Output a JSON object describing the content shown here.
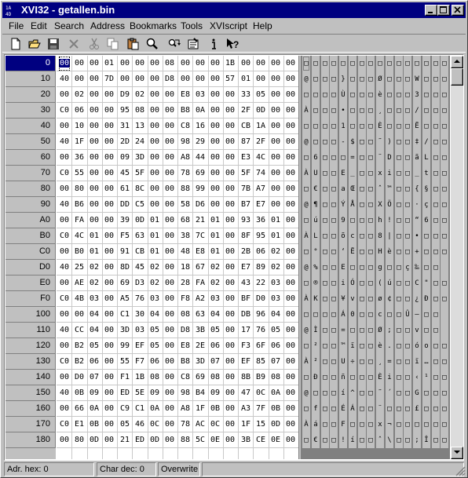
{
  "window": {
    "title": "XVI32 - getallen.bin",
    "app_icon_text": "XVI"
  },
  "menu": [
    "File",
    "Edit",
    "Search",
    "Address",
    "Bookmarks",
    "Tools",
    "XVIscript",
    "Help"
  ],
  "toolbar": [
    {
      "icon": "new-file-icon"
    },
    {
      "icon": "open-folder-icon"
    },
    {
      "icon": "save-disk-icon"
    },
    {
      "icon": "close-x-icon"
    },
    {
      "icon": "cut-scissors-icon"
    },
    {
      "icon": "copy-icon"
    },
    {
      "icon": "paste-icon"
    },
    {
      "icon": "find-magnifier-icon"
    },
    {
      "icon": "replace-icon"
    },
    {
      "icon": "settings-icon"
    },
    {
      "icon": "info-icon"
    },
    {
      "icon": "help-pointer-icon"
    }
  ],
  "addresses": [
    "0",
    "10",
    "20",
    "30",
    "40",
    "50",
    "60",
    "70",
    "80",
    "90",
    "A0",
    "B0",
    "C0",
    "D0",
    "E0",
    "F0",
    "100",
    "110",
    "120",
    "130",
    "140",
    "150",
    "160",
    "170",
    "180"
  ],
  "hex_rows": [
    [
      "00",
      "00",
      "00",
      "01",
      "00",
      "00",
      "00",
      "08",
      "00",
      "00",
      "00",
      "1B",
      "00",
      "00",
      "00"
    ],
    [
      "40",
      "00",
      "00",
      "7D",
      "00",
      "00",
      "00",
      "D8",
      "00",
      "00",
      "00",
      "57",
      "01",
      "00",
      "00"
    ],
    [
      "00",
      "02",
      "00",
      "00",
      "D9",
      "02",
      "00",
      "00",
      "E8",
      "03",
      "00",
      "00",
      "33",
      "05",
      "00"
    ],
    [
      "C0",
      "06",
      "00",
      "00",
      "95",
      "08",
      "00",
      "00",
      "B8",
      "0A",
      "00",
      "00",
      "2F",
      "0D",
      "00"
    ],
    [
      "00",
      "10",
      "00",
      "00",
      "31",
      "13",
      "00",
      "00",
      "C8",
      "16",
      "00",
      "00",
      "CB",
      "1A",
      "00"
    ],
    [
      "40",
      "1F",
      "00",
      "00",
      "2D",
      "24",
      "00",
      "00",
      "98",
      "29",
      "00",
      "00",
      "87",
      "2F",
      "00"
    ],
    [
      "00",
      "36",
      "00",
      "00",
      "09",
      "3D",
      "00",
      "00",
      "A8",
      "44",
      "00",
      "00",
      "E3",
      "4C",
      "00"
    ],
    [
      "C0",
      "55",
      "00",
      "00",
      "45",
      "5F",
      "00",
      "00",
      "78",
      "69",
      "00",
      "00",
      "5F",
      "74",
      "00"
    ],
    [
      "00",
      "80",
      "00",
      "00",
      "61",
      "8C",
      "00",
      "00",
      "88",
      "99",
      "00",
      "00",
      "7B",
      "A7",
      "00"
    ],
    [
      "40",
      "B6",
      "00",
      "00",
      "DD",
      "C5",
      "00",
      "00",
      "58",
      "D6",
      "00",
      "00",
      "B7",
      "E7",
      "00"
    ],
    [
      "00",
      "FA",
      "00",
      "00",
      "39",
      "0D",
      "01",
      "00",
      "68",
      "21",
      "01",
      "00",
      "93",
      "36",
      "01"
    ],
    [
      "C0",
      "4C",
      "01",
      "00",
      "F5",
      "63",
      "01",
      "00",
      "38",
      "7C",
      "01",
      "00",
      "8F",
      "95",
      "01"
    ],
    [
      "00",
      "B0",
      "01",
      "00",
      "91",
      "CB",
      "01",
      "00",
      "48",
      "E8",
      "01",
      "00",
      "2B",
      "06",
      "02"
    ],
    [
      "40",
      "25",
      "02",
      "00",
      "8D",
      "45",
      "02",
      "00",
      "18",
      "67",
      "02",
      "00",
      "E7",
      "89",
      "02"
    ],
    [
      "00",
      "AE",
      "02",
      "00",
      "69",
      "D3",
      "02",
      "00",
      "28",
      "FA",
      "02",
      "00",
      "43",
      "22",
      "03"
    ],
    [
      "C0",
      "4B",
      "03",
      "00",
      "A5",
      "76",
      "03",
      "00",
      "F8",
      "A2",
      "03",
      "00",
      "BF",
      "D0",
      "03"
    ],
    [
      "00",
      "00",
      "04",
      "00",
      "C1",
      "30",
      "04",
      "00",
      "08",
      "63",
      "04",
      "00",
      "DB",
      "96",
      "04"
    ],
    [
      "40",
      "CC",
      "04",
      "00",
      "3D",
      "03",
      "05",
      "00",
      "D8",
      "3B",
      "05",
      "00",
      "17",
      "76",
      "05"
    ],
    [
      "00",
      "B2",
      "05",
      "00",
      "99",
      "EF",
      "05",
      "00",
      "E8",
      "2E",
      "06",
      "00",
      "F3",
      "6F",
      "06"
    ],
    [
      "C0",
      "B2",
      "06",
      "00",
      "55",
      "F7",
      "06",
      "00",
      "B8",
      "3D",
      "07",
      "00",
      "EF",
      "85",
      "07"
    ],
    [
      "00",
      "D0",
      "07",
      "00",
      "F1",
      "1B",
      "08",
      "00",
      "C8",
      "69",
      "08",
      "00",
      "8B",
      "B9",
      "08"
    ],
    [
      "40",
      "0B",
      "09",
      "00",
      "ED",
      "5E",
      "09",
      "00",
      "98",
      "B4",
      "09",
      "00",
      "47",
      "0C",
      "0A"
    ],
    [
      "00",
      "66",
      "0A",
      "00",
      "C9",
      "C1",
      "0A",
      "00",
      "A8",
      "1F",
      "0B",
      "00",
      "A3",
      "7F",
      "0B"
    ],
    [
      "C0",
      "E1",
      "0B",
      "00",
      "05",
      "46",
      "0C",
      "00",
      "78",
      "AC",
      "0C",
      "00",
      "1F",
      "15",
      "0D"
    ],
    [
      "00",
      "80",
      "0D",
      "00",
      "21",
      "ED",
      "0D",
      "00",
      "88",
      "5C",
      "0E",
      "00",
      "3B",
      "CE",
      "0E"
    ]
  ],
  "hex_last_col": [
    "00",
    "00",
    "00",
    "00",
    "00",
    "00",
    "00",
    "00",
    "00",
    "00",
    "00",
    "00",
    "00",
    "00",
    "00",
    "00",
    "00",
    "00",
    "00",
    "00",
    "00",
    "00",
    "00",
    "00",
    "00"
  ],
  "char_rows": [
    "□□□□□□□□□□□□□□□□",
    "@□□□}□□□Ø□□□W□□□",
    "□□□□Ù□□□è□□□3□□□",
    "À□□□•□□□¸□□□/□□□",
    "□□□□1□□□È□□□Ë□□□",
    "@□□□-$□□˜)□□‡/□□",
    "□6□□□=□□¨D□□ãL□□",
    "ÀU□□E_□□xi□□_t□□",
    "□€□□aŒ□□ˆ™□□{§□□",
    "@¶□□ÝÅ□□XÖ□□·ç□□",
    "□ú□□9□□□h!□□“6□□",
    "ÀL□□õc□□8|□□•□□□",
    "□°□□‘Ë□□Hè□□+□□□",
    "@%□□E□□□g□□ç‰□□",
    "□®□□iÓ□□(ú□□C\"□□",
    "ÀK□□¥v□□ø¢□□¿Ð□□",
    "□□□□Á0□□c□□Û–□□",
    "@Ì□□=□□□Ø;□□v□□",
    "□²□□™ï□□è.□□óo□□",
    "À²□□U÷□□¸=□□ï…□□",
    "□Ð□□ñ□□□Èi□□‹¹□□",
    "@□□□í^□□˜´□□G□□□",
    "□f□□ÉÁ□□¨□□□£□□□",
    "Àá□□F□□□x¬□□□□□□",
    "□€□□!í□□ˆ\\□□;Î□□"
  ],
  "status": {
    "adr_hex": "Adr. hex: 0",
    "char_dec": "Char dec: 0",
    "mode": "Overwrite"
  }
}
